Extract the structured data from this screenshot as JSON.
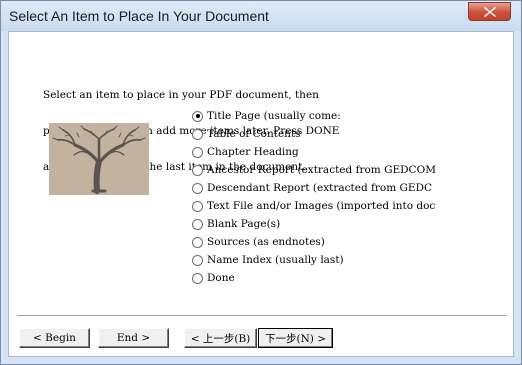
{
  "window": {
    "title": "Select An Item to Place In Your Document"
  },
  "instructions": {
    "lines": [
      "Select an item to place in your PDF document, then",
      "press NEXT. You can add more items later. Press DONE",
      "after you've added the last item in the document."
    ]
  },
  "options": [
    {
      "label": "Title Page (usually come:",
      "checked": true
    },
    {
      "label": "Table of Contents",
      "checked": false
    },
    {
      "label": "Chapter Heading",
      "checked": false
    },
    {
      "label": "Ancestor Report (extracted from GEDCOM",
      "checked": false
    },
    {
      "label": "Descendant Report (extracted from GEDC",
      "checked": false
    },
    {
      "label": "Text File and/or Images (imported into doc",
      "checked": false
    },
    {
      "label": "Blank Page(s)",
      "checked": false
    },
    {
      "label": "Sources (as endnotes)",
      "checked": false
    },
    {
      "label": "Name Index (usually last)",
      "checked": false
    },
    {
      "label": "Done",
      "checked": false
    }
  ],
  "buttons": {
    "begin": "< Begin",
    "end": "End >",
    "prev": "< 上一步(B)",
    "next": "下一步(N) >"
  },
  "colors": {
    "frame": "#d4e4f4",
    "close_button": "#c8523d",
    "image_background": "#c4b2a0",
    "tree": "#5a5450"
  },
  "icons": {
    "close": "close-icon",
    "image": "tree-image"
  }
}
